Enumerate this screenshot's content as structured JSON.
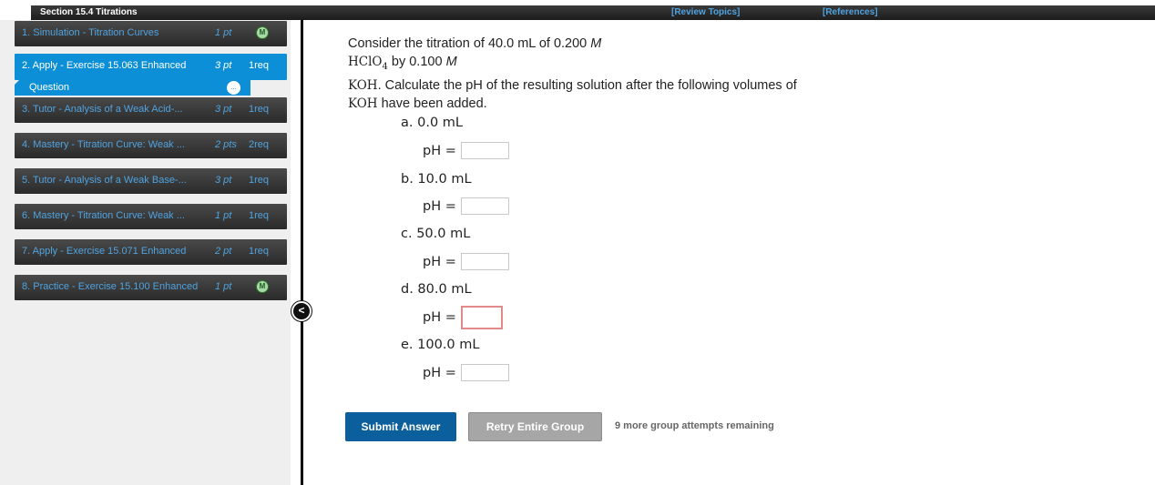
{
  "header": {
    "section_title": "Section 15.4 Titrations",
    "review_link": "[Review Topics]",
    "references_link": "[References]"
  },
  "sidebar": {
    "items": [
      {
        "label": "1. Simulation - Titration Curves",
        "points": "1 pt",
        "req": "",
        "badge": "M"
      },
      {
        "label": "2. Apply - Exercise 15.063 Enhanced",
        "points": "3 pt",
        "req": "1req",
        "badge": "",
        "sub_label": "Question"
      },
      {
        "label": "3. Tutor - Analysis of a Weak Acid-...",
        "points": "3 pt",
        "req": "1req",
        "badge": ""
      },
      {
        "label": "4. Mastery - Titration Curve: Weak ...",
        "points": "2 pts",
        "req": "2req",
        "badge": ""
      },
      {
        "label": "5. Tutor - Analysis of a Weak Base-...",
        "points": "3 pt",
        "req": "1req",
        "badge": ""
      },
      {
        "label": "6. Mastery - Titration Curve: Weak ...",
        "points": "1 pt",
        "req": "1req",
        "badge": ""
      },
      {
        "label": "7. Apply - Exercise 15.071 Enhanced",
        "points": "2 pt",
        "req": "1req",
        "badge": ""
      },
      {
        "label": "8. Practice - Exercise 15.100 Enhanced",
        "points": "1 pt",
        "req": "",
        "badge": "M"
      }
    ],
    "collapse_glyph": "<",
    "more_glyph": "..."
  },
  "question": {
    "line1_text": "Consider the titration of 40.0 mL of 0.200 ",
    "line1_unit": "M",
    "acid_formula": "HClO",
    "acid_subscript": "4",
    "line2_text": " by 0.100 ",
    "line2_unit": "M",
    "base_formula": "KOH",
    "line3_text": ". Calculate the pH of the resulting solution after the following volumes of",
    "base_formula_2": "KOH",
    "line4_text": " have been added."
  },
  "parts": [
    {
      "label": "a. 0.0 mL",
      "ph_label": "pH =",
      "value": ""
    },
    {
      "label": "b. 10.0 mL",
      "ph_label": "pH =",
      "value": ""
    },
    {
      "label": "c. 50.0 mL",
      "ph_label": "pH =",
      "value": ""
    },
    {
      "label": "d. 80.0 mL",
      "ph_label": "pH =",
      "value": ""
    },
    {
      "label": "e. 100.0 mL",
      "ph_label": "pH =",
      "value": ""
    }
  ],
  "actions": {
    "submit_label": "Submit Answer",
    "retry_label": "Retry Entire Group",
    "attempts_text": "9 more group attempts remaining"
  },
  "colors": {
    "active_nav": "#0c8fd6",
    "nav_text": "#4fa3e0",
    "submit_bg": "#0b5f9c",
    "retry_bg": "#a6a6a6",
    "active_input_border": "#e58a8a"
  }
}
